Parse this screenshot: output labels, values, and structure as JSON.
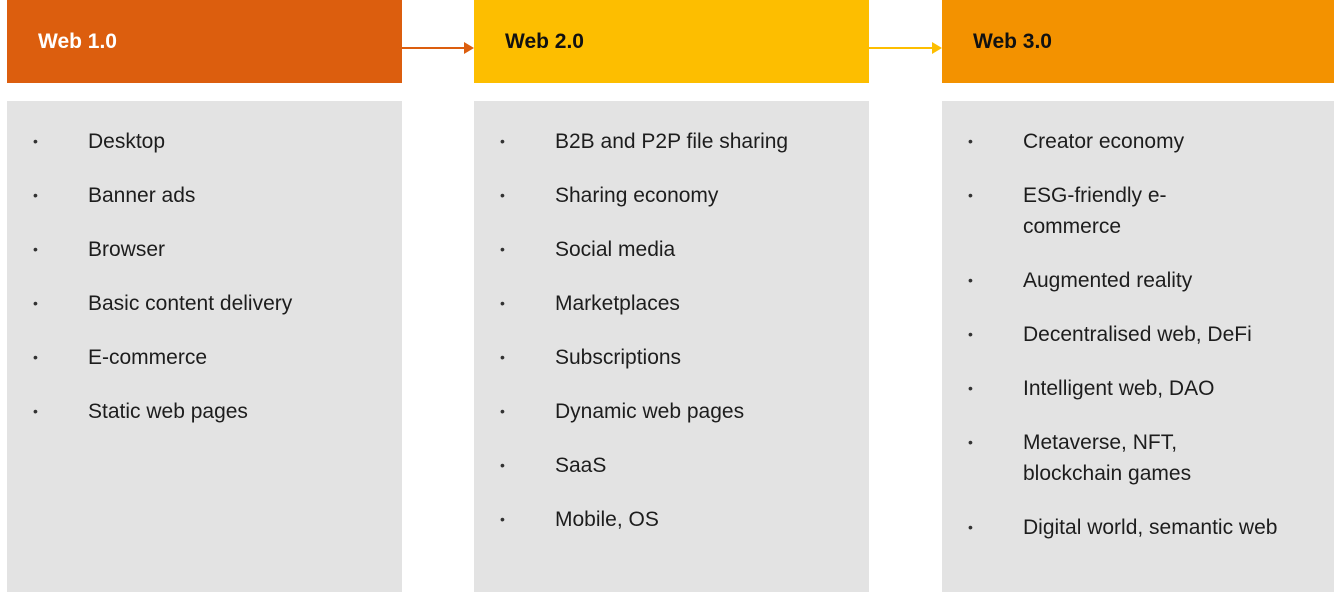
{
  "colors": {
    "web1": "#dc5e0e",
    "web2": "#fdbe00",
    "web3": "#f39200",
    "panel": "#e3e3e3"
  },
  "columns": [
    {
      "title": "Web 1.0",
      "items": [
        "Desktop",
        "Banner ads",
        "Browser",
        "Basic content delivery",
        "E-commerce",
        "Static web pages"
      ]
    },
    {
      "title": "Web 2.0",
      "items": [
        "B2B and P2P file sharing",
        "Sharing economy",
        "Social media",
        "Marketplaces",
        "Subscriptions",
        "Dynamic web pages",
        "SaaS",
        "Mobile, OS"
      ]
    },
    {
      "title": "Web 3.0",
      "items": [
        "Creator economy",
        "ESG-friendly e-commerce",
        "Augmented reality",
        "Decentralised web, DeFi",
        "Intelligent web, DAO",
        "Metaverse, NFT, blockchain games",
        "Digital world, semantic web"
      ]
    }
  ]
}
